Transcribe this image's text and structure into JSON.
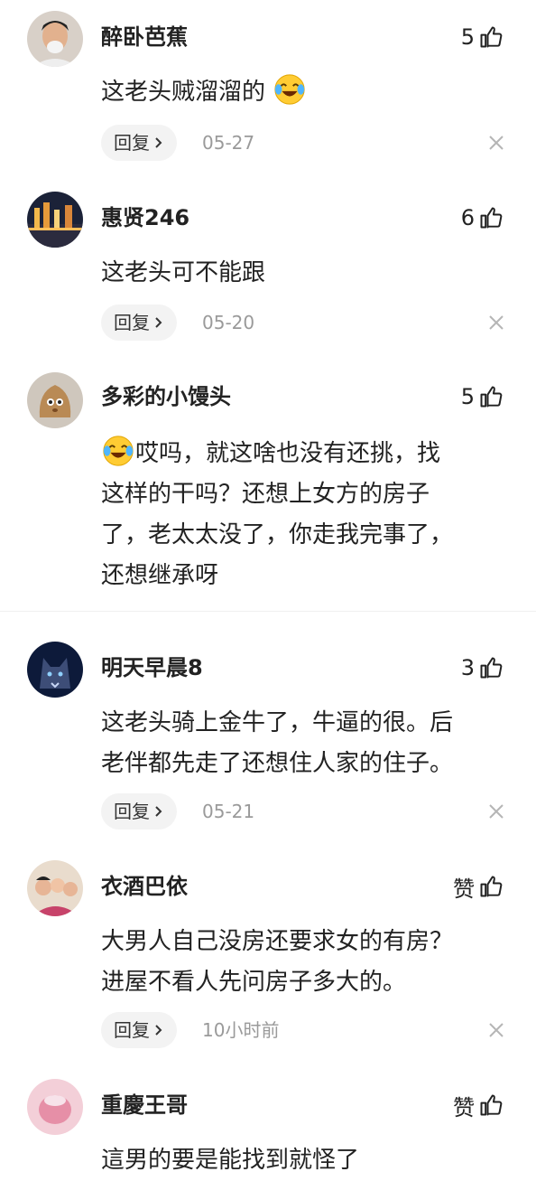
{
  "comments": [
    {
      "name": "醉卧芭蕉",
      "likes": "5",
      "text": "这老头贼溜溜的",
      "date": "05-27",
      "reply": "回复",
      "emoji_after": true
    },
    {
      "name": "惠贤246",
      "likes": "6",
      "text": "这老头可不能跟",
      "date": "05-20",
      "reply": "回复"
    },
    {
      "name": "多彩的小馒头",
      "likes": "5",
      "text_lines": [
        "哎吗，就这啥也没有还挑，找",
        "这样的干吗？还想上女方的房子",
        "了，老太太没了，你走我完事了，",
        "还想继承呀"
      ]
    },
    {
      "name": "明天早晨8",
      "likes": "3",
      "text_lines": [
        "这老头骑上金牛了，牛逼的很。后",
        "老伴都先走了还想住人家的住子。"
      ],
      "date": "05-21",
      "reply": "回复"
    },
    {
      "name": "衣酒巴依",
      "likes": "赞",
      "text_lines": [
        "大男人自己没房还要求女的有房？",
        "进屋不看人先问房子多大的。"
      ],
      "date": "10小时前",
      "reply": "回复"
    },
    {
      "name": "重慶王哥",
      "likes": "赞",
      "text": "這男的要是能找到就怪了"
    }
  ],
  "icons": {
    "like": "thumbs-up-icon",
    "close": "close-icon",
    "chevron": "chevron-right-icon",
    "emoji": "crying-laughing-emoji-icon"
  }
}
